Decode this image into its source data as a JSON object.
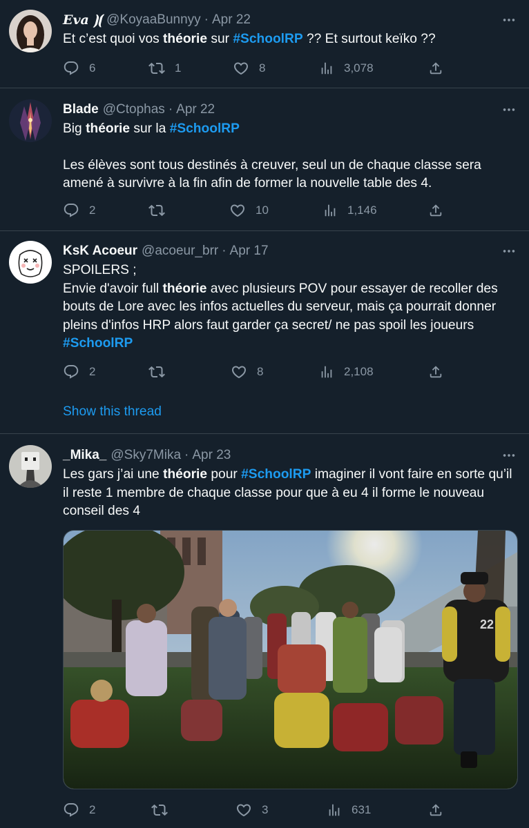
{
  "tweets": [
    {
      "name": "𝑬𝒗𝒂 ⦘⦗",
      "handle": "@KoyaaBunnyy",
      "dot": "·",
      "date": "Apr 22",
      "text_1": "Et c’est quoi vos ",
      "bold_1": "théorie",
      "text_2": " sur  ",
      "hashtag": "#SchoolRP",
      "text_3": " ?? Et surtout keïko ??",
      "replies": "6",
      "retweets": "1",
      "likes": "8",
      "views": "3,078"
    },
    {
      "name": "Blade",
      "handle": "@Ctophas",
      "dot": "·",
      "date": "Apr 22",
      "text_1": "Big ",
      "bold_1": "théorie",
      "text_2": " sur la ",
      "hashtag": "#SchoolRP",
      "text_3": "Les élèves sont tous destinés à creuver, seul un de chaque classe sera amené à survivre à la fin afin de former la nouvelle table des 4.",
      "replies": "2",
      "retweets": "",
      "likes": "10",
      "views": "1,146"
    },
    {
      "name": "KsK Acoeur",
      "handle": "@acoeur_brr",
      "dot": "·",
      "date": "Apr 17",
      "line_1": "SPOILERS ;",
      "text_1": "Envie d'avoir full ",
      "bold_1": "théorie",
      "text_2": " avec plusieurs POV pour essayer de recoller des bouts de Lore avec les infos actuelles du serveur, mais ça pourrait donner pleins d'infos HRP alors faut garder ça secret/ ne pas spoil les joueurs",
      "hashtag": "#SchoolRP",
      "replies": "2",
      "retweets": "",
      "likes": "8",
      "views": "2,108",
      "show_thread": "Show this thread"
    },
    {
      "name": "_Mika_",
      "handle": "@Sky7Mika",
      "dot": "·",
      "date": "Apr 23",
      "text_1": "Les gars j’ai une ",
      "bold_1": "théorie",
      "text_2": " pour ",
      "hashtag": "#SchoolRP",
      "text_3": " imaginer il vont faire en sorte qu’il il reste  1 membre de chaque classe pour que à eu 4 il forme le nouveau conseil des 4",
      "replies": "2",
      "retweets": "",
      "likes": "3",
      "views": "631",
      "media_jersey_number": "22"
    }
  ],
  "icons": {
    "reply": "reply-icon",
    "retweet": "retweet-icon",
    "like": "heart-icon",
    "views": "views-icon",
    "share": "share-icon",
    "more": "more-icon"
  },
  "colors": {
    "background": "#15202b",
    "border": "#38444d",
    "text": "#f7f9f9",
    "secondary": "#8b98a5",
    "accent": "#1d9bf0"
  }
}
